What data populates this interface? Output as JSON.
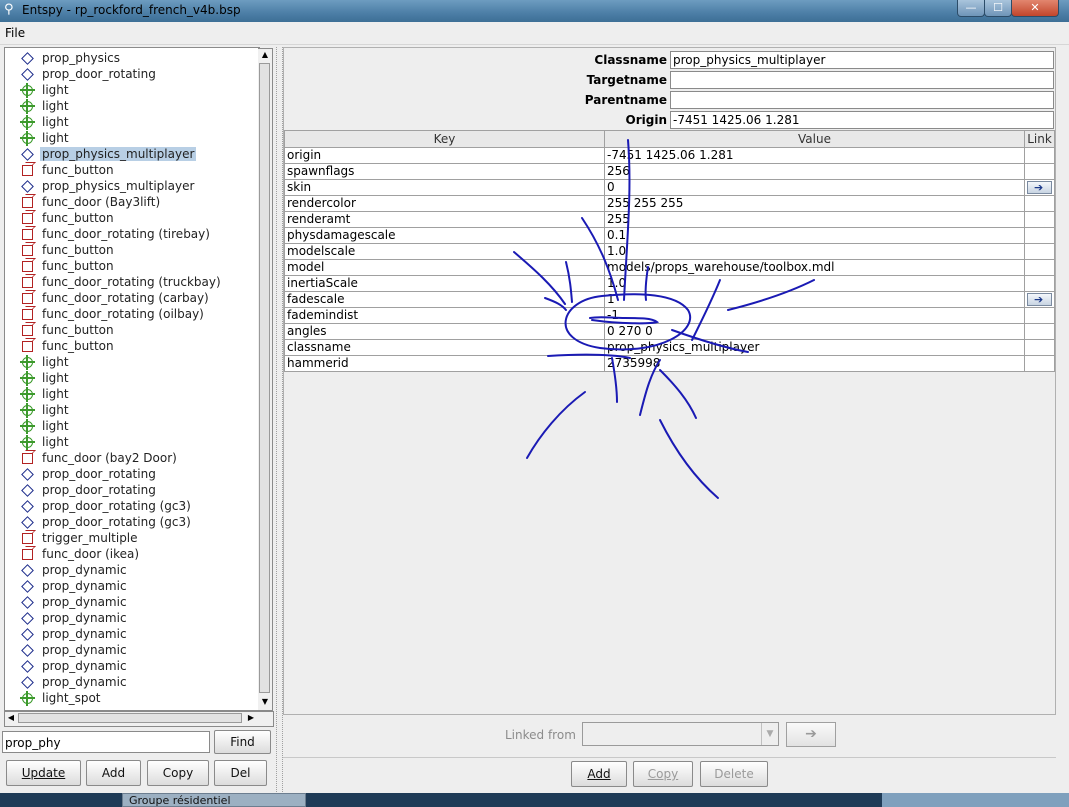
{
  "window": {
    "title": "Entspy - rp_rockford_french_v4b.bsp",
    "minimize_glyph": "—",
    "maximize_glyph": "☐",
    "close_glyph": "✕"
  },
  "menu": {
    "file_label": "File"
  },
  "tree": {
    "items": [
      {
        "label": "prop_physics",
        "icon": "diamond-icon",
        "selected": false
      },
      {
        "label": "prop_door_rotating",
        "icon": "diamond-icon",
        "selected": false
      },
      {
        "label": "light",
        "icon": "crosshair-icon",
        "selected": false
      },
      {
        "label": "light",
        "icon": "crosshair-icon",
        "selected": false
      },
      {
        "label": "light",
        "icon": "crosshair-icon",
        "selected": false
      },
      {
        "label": "light",
        "icon": "crosshair-icon",
        "selected": false
      },
      {
        "label": "prop_physics_multiplayer",
        "icon": "diamond-icon",
        "selected": true
      },
      {
        "label": "func_button",
        "icon": "cube-icon",
        "selected": false
      },
      {
        "label": "prop_physics_multiplayer",
        "icon": "diamond-icon",
        "selected": false
      },
      {
        "label": "func_door (Bay3lift)",
        "icon": "cube-icon",
        "selected": false
      },
      {
        "label": "func_button",
        "icon": "cube-icon",
        "selected": false
      },
      {
        "label": "func_door_rotating (tirebay)",
        "icon": "cube-icon",
        "selected": false
      },
      {
        "label": "func_button",
        "icon": "cube-icon",
        "selected": false
      },
      {
        "label": "func_button",
        "icon": "cube-icon",
        "selected": false
      },
      {
        "label": "func_door_rotating (truckbay)",
        "icon": "cube-icon",
        "selected": false
      },
      {
        "label": "func_door_rotating (carbay)",
        "icon": "cube-icon",
        "selected": false
      },
      {
        "label": "func_door_rotating (oilbay)",
        "icon": "cube-icon",
        "selected": false
      },
      {
        "label": "func_button",
        "icon": "cube-icon",
        "selected": false
      },
      {
        "label": "func_button",
        "icon": "cube-icon",
        "selected": false
      },
      {
        "label": "light",
        "icon": "crosshair-icon",
        "selected": false
      },
      {
        "label": "light",
        "icon": "crosshair-icon",
        "selected": false
      },
      {
        "label": "light",
        "icon": "crosshair-icon",
        "selected": false
      },
      {
        "label": "light",
        "icon": "crosshair-icon",
        "selected": false
      },
      {
        "label": "light",
        "icon": "crosshair-icon",
        "selected": false
      },
      {
        "label": "light",
        "icon": "crosshair-icon",
        "selected": false
      },
      {
        "label": "func_door (bay2 Door)",
        "icon": "cube-icon",
        "selected": false
      },
      {
        "label": "prop_door_rotating",
        "icon": "diamond-icon",
        "selected": false
      },
      {
        "label": "prop_door_rotating",
        "icon": "diamond-icon",
        "selected": false
      },
      {
        "label": "prop_door_rotating (gc3)",
        "icon": "diamond-icon",
        "selected": false
      },
      {
        "label": "prop_door_rotating (gc3)",
        "icon": "diamond-icon",
        "selected": false
      },
      {
        "label": "trigger_multiple",
        "icon": "cube-icon",
        "selected": false
      },
      {
        "label": "func_door (ikea)",
        "icon": "cube-icon",
        "selected": false
      },
      {
        "label": "prop_dynamic",
        "icon": "diamond-icon",
        "selected": false
      },
      {
        "label": "prop_dynamic",
        "icon": "diamond-icon",
        "selected": false
      },
      {
        "label": "prop_dynamic",
        "icon": "diamond-icon",
        "selected": false
      },
      {
        "label": "prop_dynamic",
        "icon": "diamond-icon",
        "selected": false
      },
      {
        "label": "prop_dynamic",
        "icon": "diamond-icon",
        "selected": false
      },
      {
        "label": "prop_dynamic",
        "icon": "diamond-icon",
        "selected": false
      },
      {
        "label": "prop_dynamic",
        "icon": "diamond-icon",
        "selected": false
      },
      {
        "label": "prop_dynamic",
        "icon": "diamond-icon",
        "selected": false
      },
      {
        "label": "light_spot",
        "icon": "crosshair-icon",
        "selected": false
      }
    ]
  },
  "search": {
    "value": "prop_phy",
    "find_label": "Find"
  },
  "left_buttons": {
    "update": "Update",
    "add": "Add",
    "copy": "Copy",
    "del": "Del"
  },
  "props": {
    "classname_label": "Classname",
    "classname_value": "prop_physics_multiplayer",
    "targetname_label": "Targetname",
    "targetname_value": "",
    "parentname_label": "Parentname",
    "parentname_value": "",
    "origin_label": "Origin",
    "origin_value": "-7451 1425.06 1.281"
  },
  "grid": {
    "headers": {
      "key": "Key",
      "value": "Value",
      "link": "Link"
    },
    "rows": [
      {
        "key": "origin",
        "value": "-7451 1425.06 1.281",
        "link": false
      },
      {
        "key": "spawnflags",
        "value": "256",
        "link": false
      },
      {
        "key": "skin",
        "value": "0",
        "link": true
      },
      {
        "key": "rendercolor",
        "value": "255 255 255",
        "link": false
      },
      {
        "key": "renderamt",
        "value": "255",
        "link": false
      },
      {
        "key": "physdamagescale",
        "value": "0.1",
        "link": false
      },
      {
        "key": "modelscale",
        "value": "1.0",
        "link": false
      },
      {
        "key": "model",
        "value": "models/props_warehouse/toolbox.mdl",
        "link": false
      },
      {
        "key": "inertiaScale",
        "value": "1.0",
        "link": false
      },
      {
        "key": "fadescale",
        "value": "1",
        "link": true
      },
      {
        "key": "fademindist",
        "value": "-1",
        "link": false
      },
      {
        "key": "angles",
        "value": "0 270 0",
        "link": false
      },
      {
        "key": "classname",
        "value": "prop_physics_multiplayer",
        "link": false
      },
      {
        "key": "hammerid",
        "value": "2735998",
        "link": false
      }
    ]
  },
  "linked_from": {
    "label": "Linked from",
    "go_glyph": "➔"
  },
  "bottom_buttons": {
    "add": "Add",
    "copy": "Copy",
    "delete": "Delete"
  },
  "taskbar": {
    "task_label": "Groupe résidentiel"
  },
  "colors": {
    "selection": "#b8cfe5",
    "scribble": "#1a1ab4",
    "entity_brush": "#b22222",
    "entity_point": "#3c9a2c",
    "entity_prop": "#1a2a8a"
  }
}
